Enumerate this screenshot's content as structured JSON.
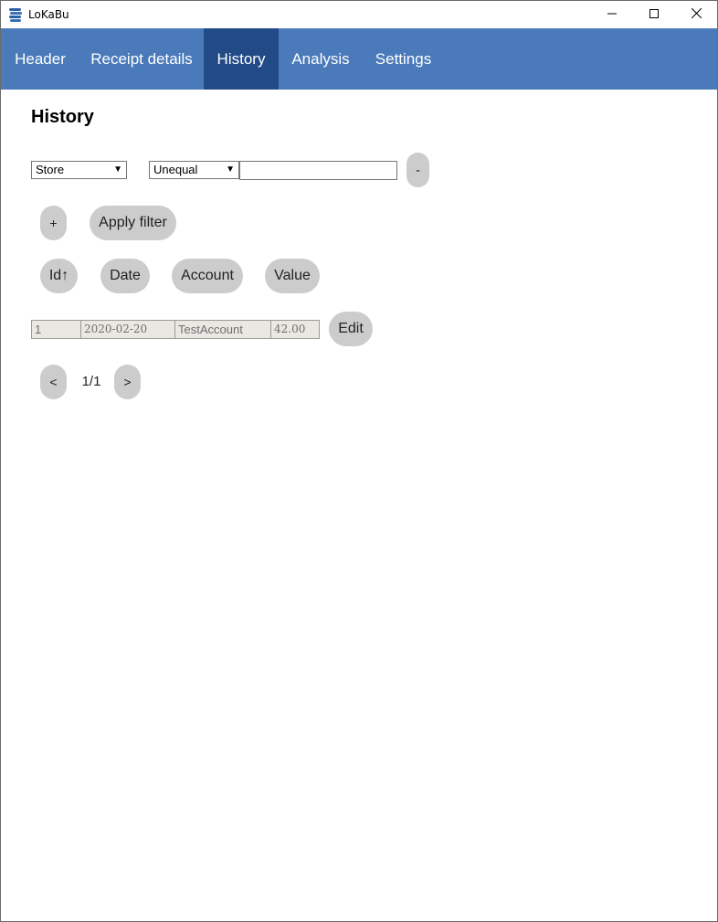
{
  "window": {
    "title": "LoKaBu",
    "icon": "stacked-coins-icon",
    "controls": {
      "minimize": "minimize-icon",
      "maximize": "maximize-icon",
      "close": "close-icon"
    }
  },
  "nav": {
    "tabs": [
      {
        "label": "Header",
        "active": false
      },
      {
        "label": "Receipt details",
        "active": false
      },
      {
        "label": "History",
        "active": true
      },
      {
        "label": "Analysis",
        "active": false
      },
      {
        "label": "Settings",
        "active": false
      }
    ],
    "colors": {
      "bar": "#4a7ab9",
      "active": "#214a87"
    }
  },
  "page": {
    "title": "History"
  },
  "filter": {
    "field_select": "Store",
    "operator_select": "Unequal",
    "value_input": "",
    "remove_label": "-",
    "add_label": "+",
    "apply_label": "Apply filter"
  },
  "sort": {
    "id_label": "Id↑",
    "date_label": "Date",
    "account_label": "Account",
    "value_label": "Value"
  },
  "rows": [
    {
      "id": "1",
      "date": "2020-02-20",
      "account": "TestAccount",
      "value": "42.00",
      "edit_label": "Edit"
    }
  ],
  "pager": {
    "prev_label": "<",
    "indicator": "1/1",
    "next_label": ">"
  }
}
